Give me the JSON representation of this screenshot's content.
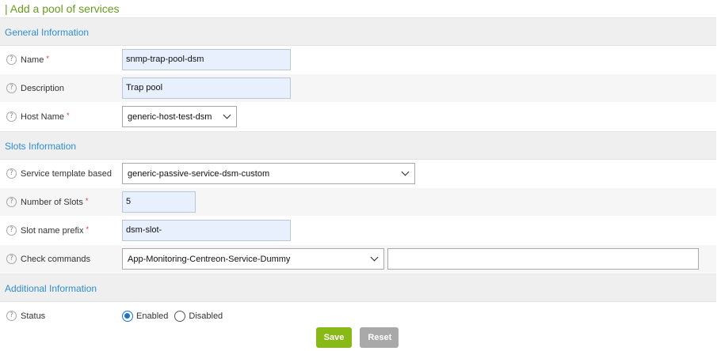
{
  "page": {
    "title": "| Add a pool of services"
  },
  "sections": {
    "general": "General Information",
    "slots": "Slots Information",
    "additional": "Additional Information"
  },
  "fields": {
    "name": {
      "label": "Name",
      "required": "*",
      "value": "snmp-trap-pool-dsm"
    },
    "description": {
      "label": "Description",
      "value": "Trap pool"
    },
    "host_name": {
      "label": "Host Name",
      "required": "*",
      "value": "generic-host-test-dsm"
    },
    "service_template": {
      "label": "Service template based",
      "value": "generic-passive-service-dsm-custom"
    },
    "number_of_slots": {
      "label": "Number of Slots",
      "required": "*",
      "value": "5"
    },
    "slot_prefix": {
      "label": "Slot name prefix",
      "required": "*",
      "value": "dsm-slot-"
    },
    "check_commands": {
      "label": "Check commands",
      "value": "App-Monitoring-Centreon-Service-Dummy",
      "args": ""
    },
    "status": {
      "label": "Status",
      "options": [
        "Enabled",
        "Disabled"
      ],
      "selected": "Enabled"
    }
  },
  "help_glyph": "?",
  "icons": {
    "help": "question-circle-icon",
    "dropdown": "chevron-down-icon"
  },
  "buttons": {
    "save": "Save",
    "reset": "Reset"
  },
  "colors": {
    "title": "#6a9a1f",
    "section": "#2f8fcf",
    "save": "#88b917",
    "reset": "#a9a9a9",
    "required": "#e0322c"
  }
}
